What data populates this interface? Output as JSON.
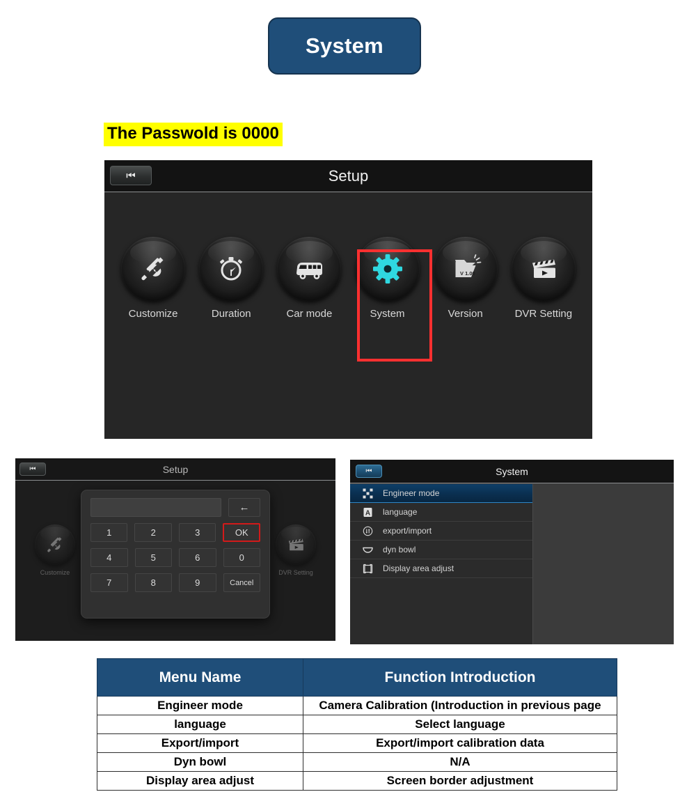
{
  "header": {
    "title": "System"
  },
  "note": {
    "text": "The Passwold is 0000",
    "highlight_color": "#ffff00"
  },
  "setup_screen": {
    "title": "Setup",
    "back_button_icon": "skip-back-icon",
    "back_button_glyph": "⏮",
    "highlight_color": "#ff3030",
    "highlighted_item": "System",
    "items": [
      {
        "label": "Customize",
        "icon": "wrench-screwdriver-icon"
      },
      {
        "label": "Duration",
        "icon": "stopwatch-icon"
      },
      {
        "label": "Car mode",
        "icon": "bus-icon"
      },
      {
        "label": "System",
        "icon": "gear-icon",
        "accent_color": "#2fd8e0"
      },
      {
        "label": "Version",
        "icon": "folder-version-icon",
        "version_text": "V 1.00"
      },
      {
        "label": "DVR Setting",
        "icon": "clapperboard-icon"
      }
    ]
  },
  "keypad_screen": {
    "title": "Setup",
    "back_button_glyph": "⏮",
    "display_value": "",
    "display_placeholder": "",
    "backspace_glyph": "←",
    "ok_label": "OK",
    "ok_border_color": "#d21a1a",
    "cancel_label": "Cancel",
    "keys_row1": [
      "1",
      "2",
      "3"
    ],
    "keys_row2": [
      "4",
      "5",
      "6"
    ],
    "keys_row3": [
      "7",
      "8",
      "9"
    ],
    "zero_label": "0",
    "background_items": [
      {
        "label": "Customize",
        "icon": "wrench-screwdriver-icon"
      },
      {
        "label": "DVR Setting",
        "icon": "clapperboard-icon"
      }
    ]
  },
  "system_screen": {
    "title": "System",
    "back_button_glyph": "⏮",
    "selected_index": 0,
    "selection_color": "#0e3f68",
    "items": [
      {
        "label": "Engineer mode",
        "icon": "calibration-dots-icon"
      },
      {
        "label": "language",
        "icon": "letter-a-box-icon"
      },
      {
        "label": "export/import",
        "icon": "transfer-circle-icon"
      },
      {
        "label": "dyn bowl",
        "icon": "bowl-icon"
      },
      {
        "label": "Display area adjust",
        "icon": "frame-brackets-icon"
      }
    ]
  },
  "table": {
    "header_color": "#1f4e79",
    "columns": [
      "Menu Name",
      "Function Introduction"
    ],
    "rows": [
      [
        "Engineer mode",
        "Camera Calibration (Introduction in previous page"
      ],
      [
        "language",
        "Select language"
      ],
      [
        "Export/import",
        "Export/import calibration data"
      ],
      [
        "Dyn bowl",
        "N/A"
      ],
      [
        "Display area adjust",
        "Screen border adjustment"
      ]
    ]
  }
}
